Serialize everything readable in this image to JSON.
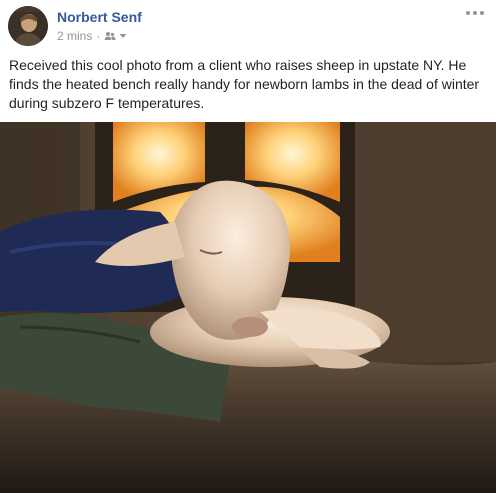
{
  "post": {
    "author": "Norbert Senf",
    "timestamp": "2 mins",
    "separator": "·",
    "audience_icon": "friends-icon",
    "more_icon": "ellipsis-icon",
    "text": "Received this cool photo from a client who raises sheep in upstate NY. He finds the heated bench really handy for newborn lambs in the dead of winter during subzero F temperatures."
  },
  "photo": {
    "subject_icon": "lamb-on-heated-bench-photo"
  },
  "colors": {
    "author_link": "#365899",
    "meta_gray": "#90949c",
    "text": "#1d2129"
  }
}
